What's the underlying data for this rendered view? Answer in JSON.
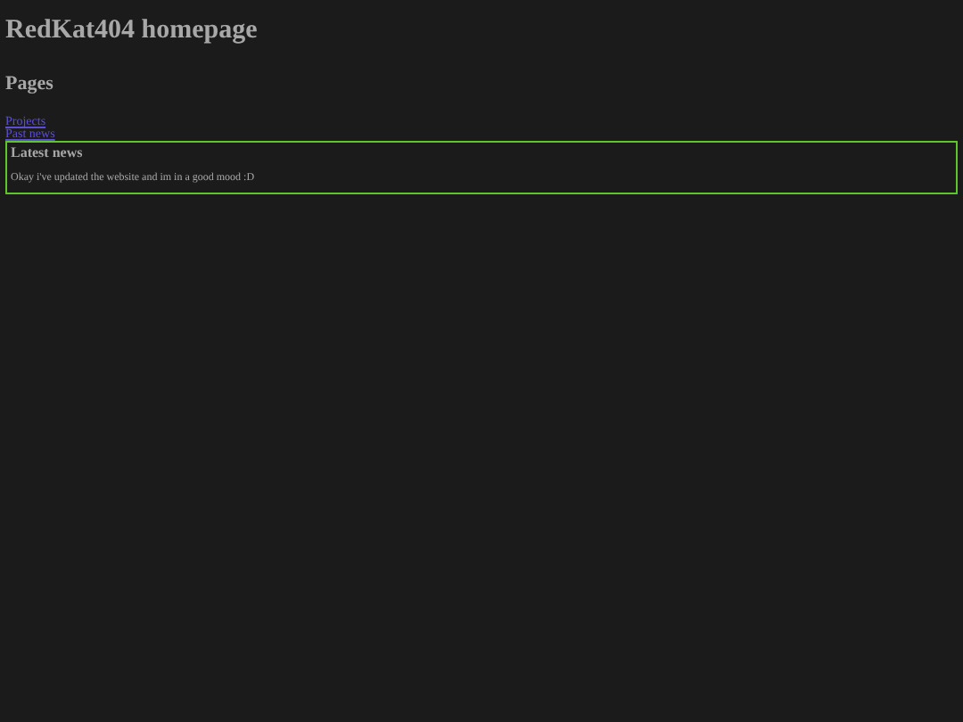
{
  "title": "RedKat404 homepage",
  "pages": {
    "heading": "Pages",
    "links": [
      "Projects",
      "Past news"
    ]
  },
  "news": {
    "heading": "Latest news",
    "text": "Okay i've updated the website and im in a good mood :D"
  }
}
